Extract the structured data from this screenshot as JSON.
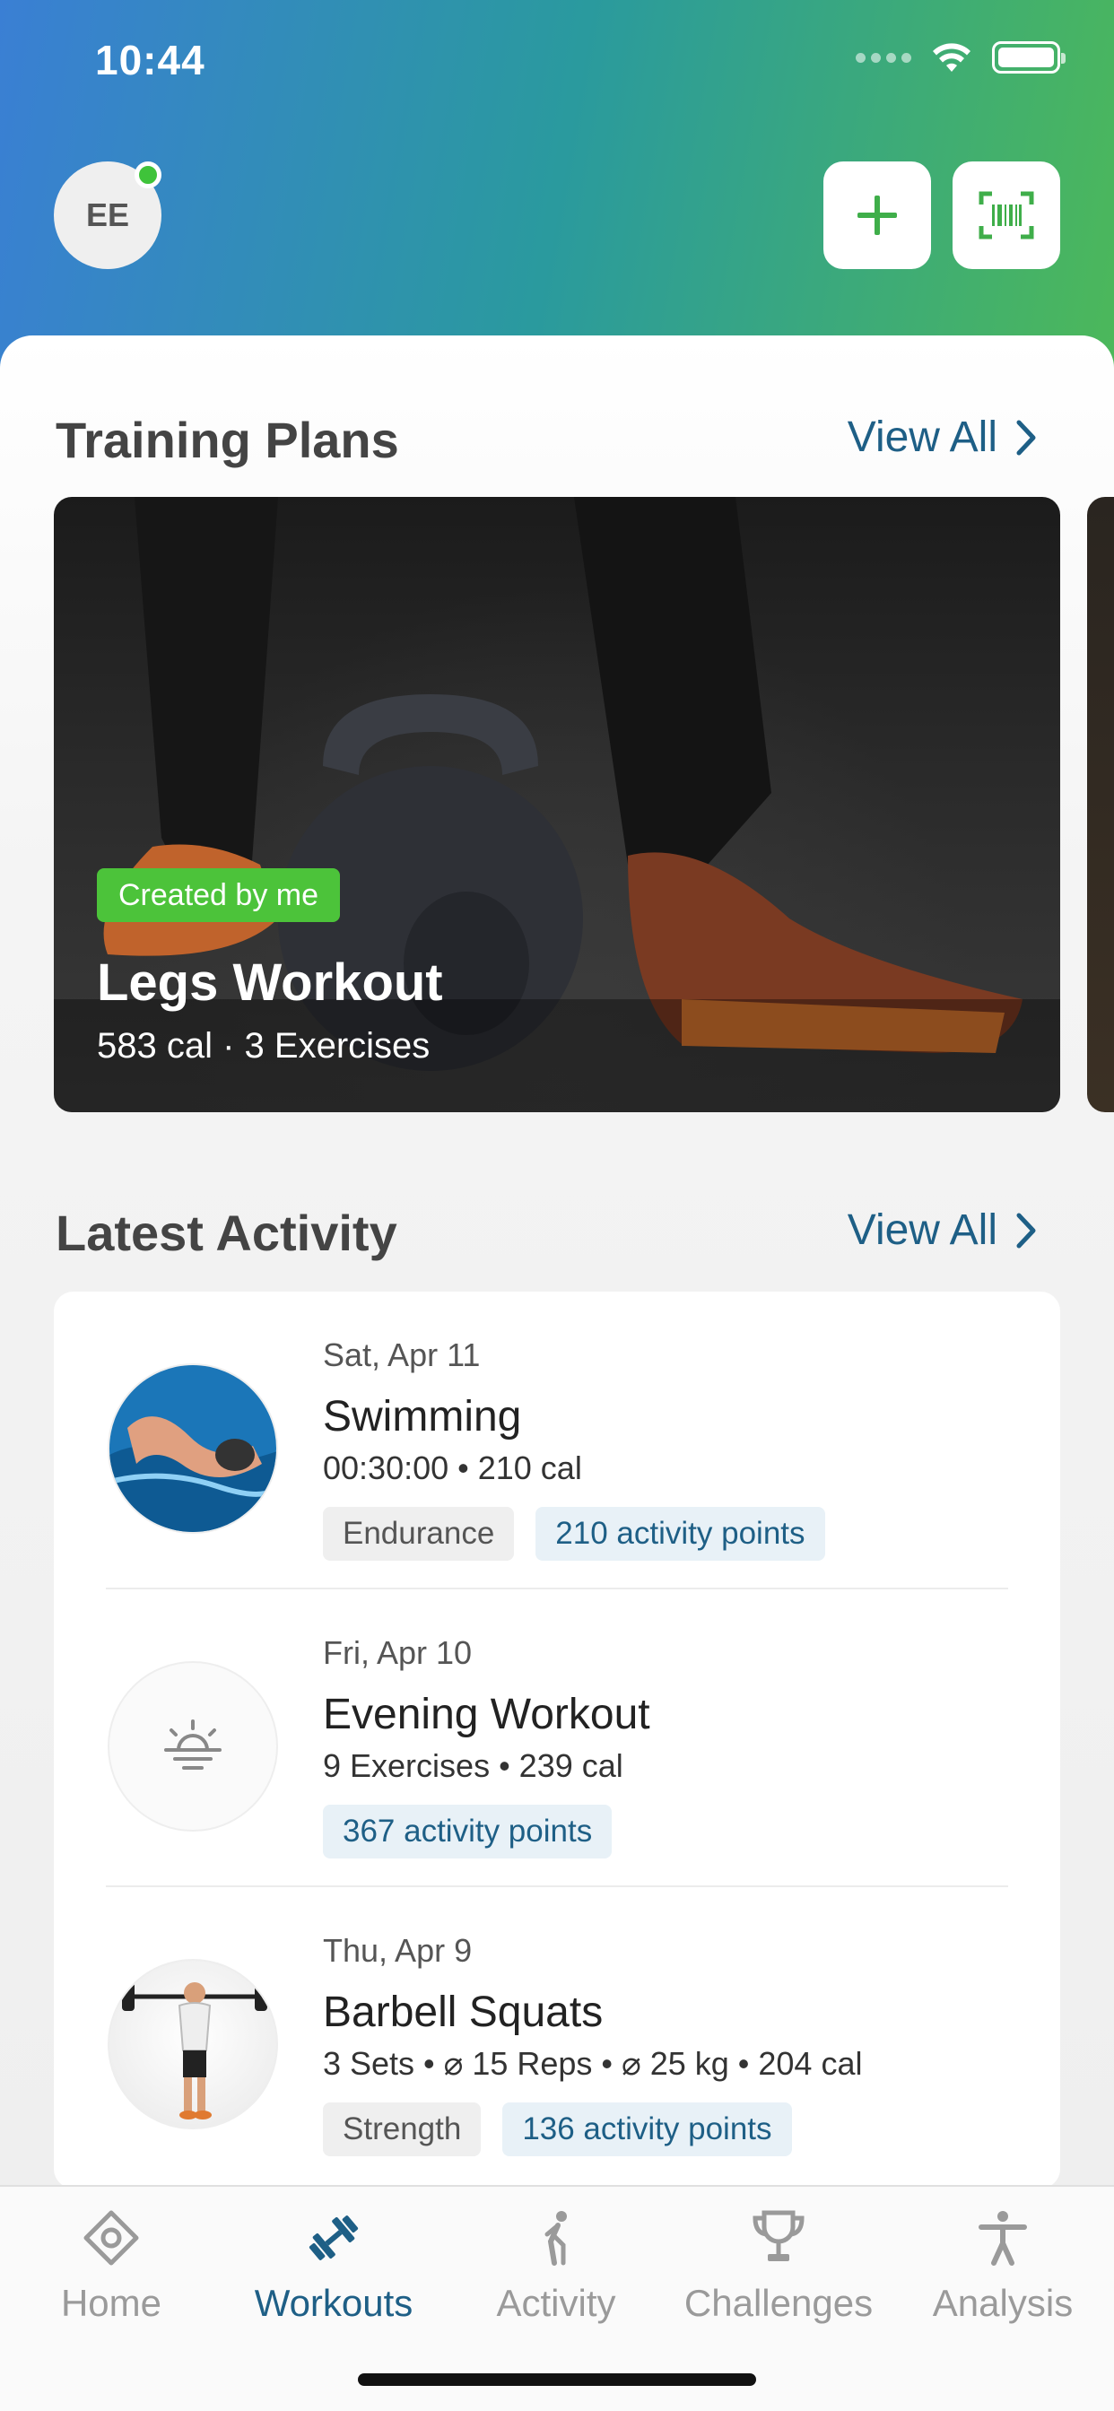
{
  "status_bar": {
    "time": "10:44"
  },
  "header": {
    "avatar_initials": "EE",
    "add_icon": "plus-icon",
    "scan_icon": "barcode-scan-icon"
  },
  "training_plans": {
    "title": "Training Plans",
    "view_all": "View All",
    "cards": [
      {
        "badge": "Created by me",
        "title": "Legs Workout",
        "meta": "583 cal · 3 Exercises"
      }
    ]
  },
  "latest_activity": {
    "title": "Latest Activity",
    "view_all": "View All",
    "items": [
      {
        "date": "Sat, Apr 11",
        "title": "Swimming",
        "meta": "00:30:00 • 210 cal",
        "tags": [
          "Endurance",
          "210 activity points"
        ],
        "icon": "swimmer-photo"
      },
      {
        "date": "Fri, Apr 10",
        "title": "Evening Workout",
        "meta": "9 Exercises • 239 cal",
        "tags": [
          "367 activity points"
        ],
        "icon": "sunset-icon"
      },
      {
        "date": "Thu, Apr 9",
        "title": "Barbell Squats",
        "meta": "3 Sets • ⌀ 15 Reps • ⌀ 25 kg • 204 cal",
        "tags": [
          "Strength",
          "136 activity points"
        ],
        "icon": "barbell-squat-figure"
      }
    ]
  },
  "tabbar": {
    "tabs": [
      {
        "label": "Home",
        "icon": "home-target-icon",
        "active": false
      },
      {
        "label": "Workouts",
        "icon": "dumbbell-icon",
        "active": true
      },
      {
        "label": "Activity",
        "icon": "runner-icon",
        "active": false
      },
      {
        "label": "Challenges",
        "icon": "trophy-icon",
        "active": false
      },
      {
        "label": "Analysis",
        "icon": "person-icon",
        "active": false
      }
    ]
  },
  "colors": {
    "accent_blue": "#1e5f86",
    "accent_green": "#4cc33a",
    "header_gradient_start": "#3a7fd4",
    "header_gradient_end": "#4cb85a"
  }
}
